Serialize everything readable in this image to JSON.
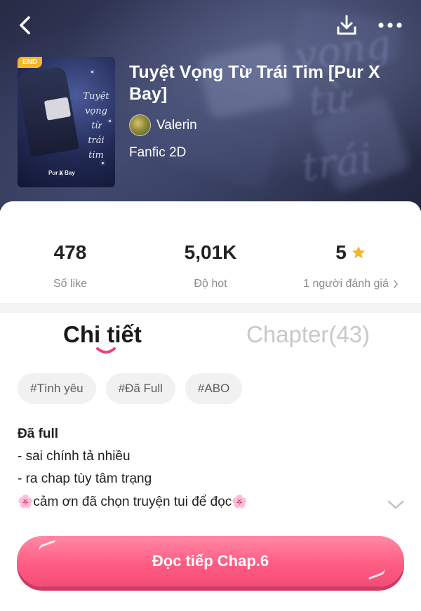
{
  "header": {
    "back_icon": "chevron-left-icon",
    "download_icon": "download-icon",
    "more_icon": "more-horizontal-icon",
    "background_text": [
      "vọng",
      "từ",
      "trái"
    ]
  },
  "book": {
    "end_badge": "END",
    "title": "Tuyệt Vọng Từ Trái Tim [Pur X Bay]",
    "cover_title_lines": [
      "Tuyệt",
      "vọng",
      "từ",
      "trái",
      "tim"
    ],
    "cover_author": "Pur X Bay",
    "author": "Valerin",
    "genre": "Fanfic 2D"
  },
  "stats": {
    "likes": {
      "value": "478",
      "label": "Số like"
    },
    "hot": {
      "value": "5,01K",
      "label": "Độ hot"
    },
    "rating": {
      "value": "5",
      "label": "1 người đánh giá",
      "star_color": "#f5b52a"
    }
  },
  "tabs": {
    "detail": "Chi tiết",
    "chapter": "Chapter(43)",
    "active": "detail",
    "accent": "#e8457a"
  },
  "tags": [
    "#Tình yêu",
    "#Đã Full",
    "#ABO"
  ],
  "description": {
    "title": "Đã full",
    "lines": [
      "- sai chính tả nhiều",
      "- ra chap tùy tâm trạng",
      "cảm ơn đã chọn truyện tui để đọc"
    ],
    "flower_icon": "🌸"
  },
  "cta": {
    "label": "Đọc tiếp Chap.6",
    "color": "#ff5c83"
  }
}
